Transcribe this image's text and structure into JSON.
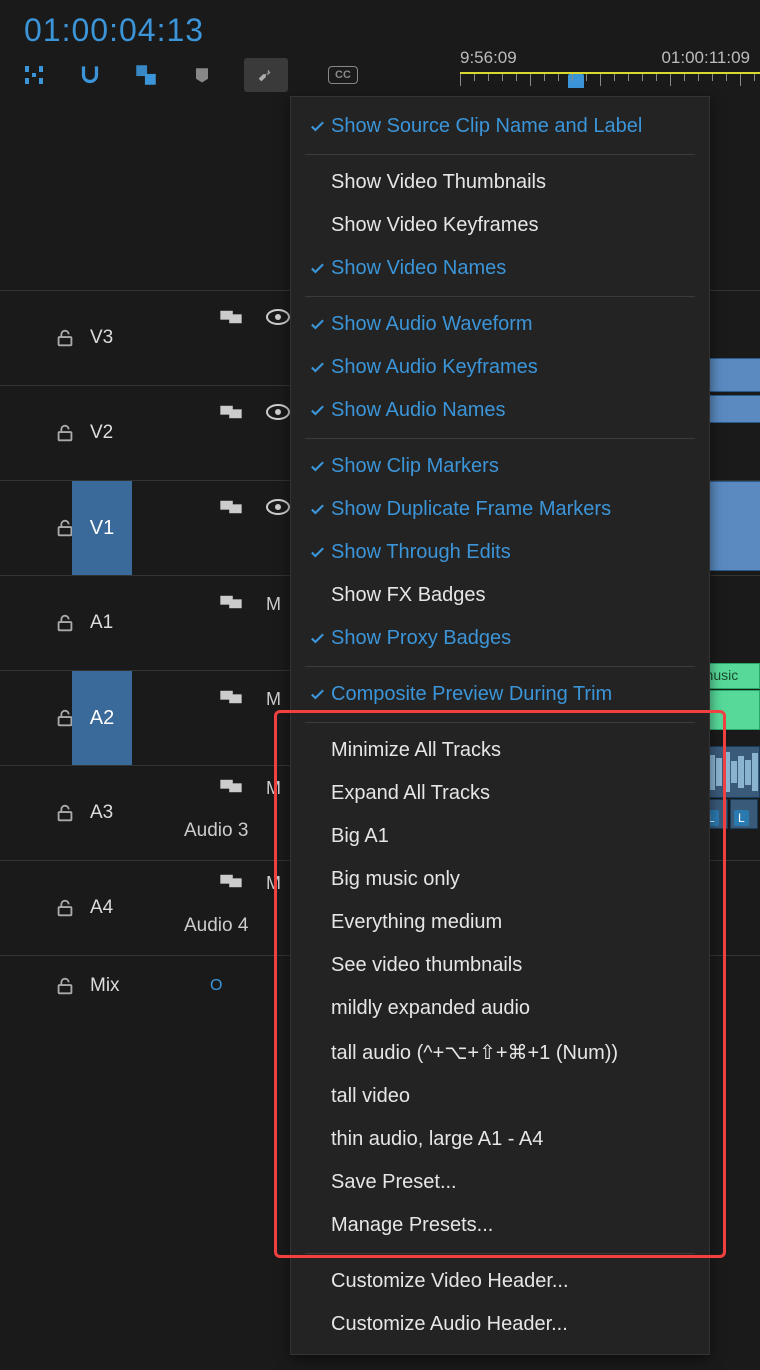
{
  "timecode": "01:00:04:13",
  "ruler": {
    "left_time": "9:56:09",
    "right_time": "01:00:11:09"
  },
  "toolbar_cc": "CC",
  "tracks": {
    "v3": "V3",
    "v2": "V2",
    "v1": "V1",
    "a1": "A1",
    "a2": "A2",
    "a3": "A3",
    "a4": "A4",
    "audio3": "Audio 3",
    "audio4": "Audio 4",
    "mix": "Mix",
    "m": "M",
    "o_label": "O"
  },
  "clip": {
    "music_label": "-music",
    "l_badge": "L"
  },
  "menu": {
    "s1": [
      {
        "label": "Show Source Clip Name and Label",
        "checked": true
      }
    ],
    "s2": [
      {
        "label": "Show Video Thumbnails",
        "checked": false
      },
      {
        "label": "Show Video Keyframes",
        "checked": false
      },
      {
        "label": "Show Video Names",
        "checked": true
      }
    ],
    "s3": [
      {
        "label": "Show Audio Waveform",
        "checked": true
      },
      {
        "label": "Show Audio Keyframes",
        "checked": true
      },
      {
        "label": "Show Audio Names",
        "checked": true
      }
    ],
    "s4": [
      {
        "label": "Show Clip Markers",
        "checked": true
      },
      {
        "label": "Show Duplicate Frame Markers",
        "checked": true
      },
      {
        "label": "Show Through Edits",
        "checked": true
      },
      {
        "label": "Show FX Badges",
        "checked": false
      },
      {
        "label": "Show Proxy Badges",
        "checked": true
      }
    ],
    "s5": [
      {
        "label": "Composite Preview During Trim",
        "checked": true
      }
    ],
    "s6": [
      "Minimize All Tracks",
      "Expand All Tracks",
      "Big A1",
      "Big music only",
      "Everything medium",
      "See video thumbnails",
      "mildly expanded audio",
      "tall audio (^+⌥+⇧+⌘+1 (Num))",
      "tall video",
      "thin audio, large A1 - A4",
      "Save Preset...",
      "Manage Presets..."
    ],
    "s7": [
      "Customize Video Header...",
      "Customize Audio Header..."
    ]
  }
}
